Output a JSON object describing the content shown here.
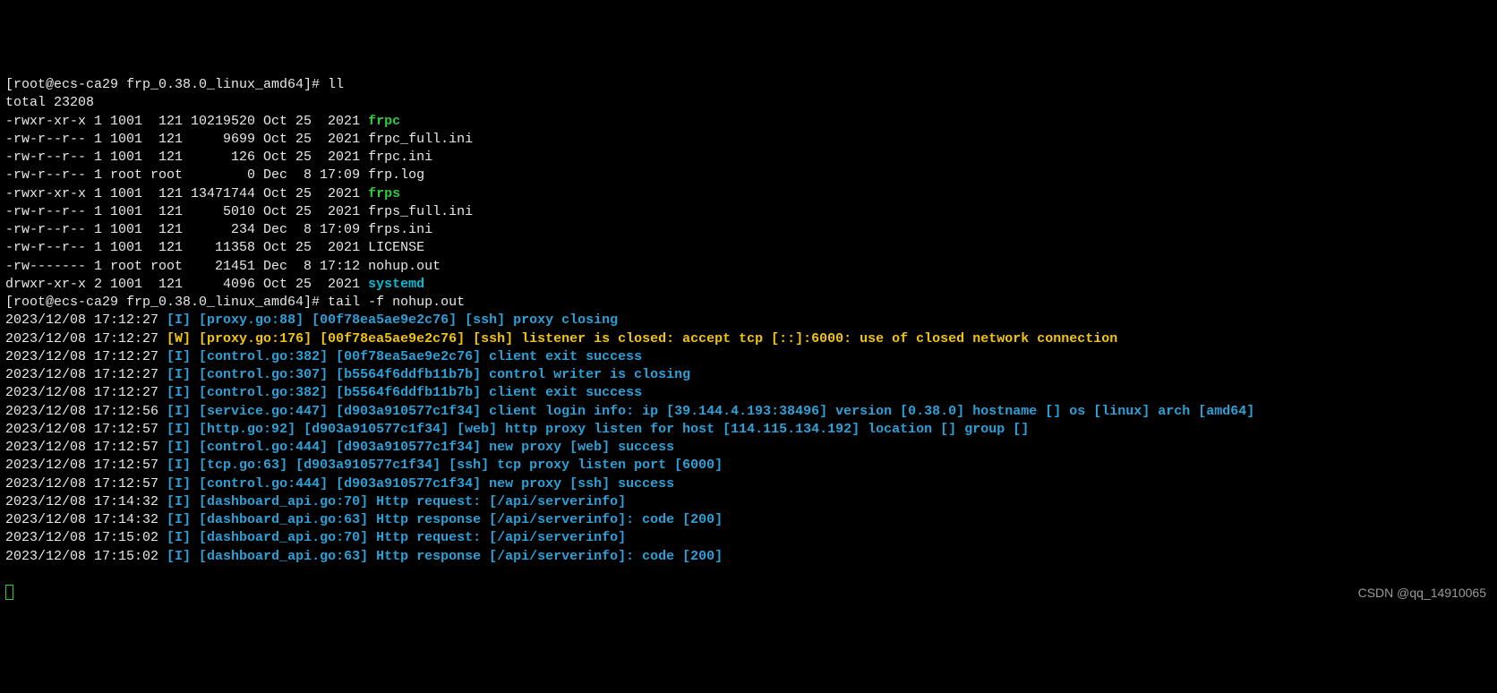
{
  "prompt1": "[root@ecs-ca29 frp_0.38.0_linux_amd64]# ll",
  "total": "total 23208",
  "ls": [
    {
      "perm": "-rwxr-xr-x 1 1001  121 10219520 Oct 25  2021 ",
      "name": "frpc",
      "cls": "green"
    },
    {
      "perm": "-rw-r--r-- 1 1001  121     9699 Oct 25  2021 ",
      "name": "frpc_full.ini",
      "cls": "white"
    },
    {
      "perm": "-rw-r--r-- 1 1001  121      126 Oct 25  2021 ",
      "name": "frpc.ini",
      "cls": "white"
    },
    {
      "perm": "-rw-r--r-- 1 root root        0 Dec  8 17:09 ",
      "name": "frp.log",
      "cls": "white"
    },
    {
      "perm": "-rwxr-xr-x 1 1001  121 13471744 Oct 25  2021 ",
      "name": "frps",
      "cls": "green"
    },
    {
      "perm": "-rw-r--r-- 1 1001  121     5010 Oct 25  2021 ",
      "name": "frps_full.ini",
      "cls": "white"
    },
    {
      "perm": "-rw-r--r-- 1 1001  121      234 Dec  8 17:09 ",
      "name": "frps.ini",
      "cls": "white"
    },
    {
      "perm": "-rw-r--r-- 1 1001  121    11358 Oct 25  2021 ",
      "name": "LICENSE",
      "cls": "white"
    },
    {
      "perm": "-rw------- 1 root root    21451 Dec  8 17:12 ",
      "name": "nohup.out",
      "cls": "white"
    },
    {
      "perm": "drwxr-xr-x 2 1001  121     4096 Oct 25  2021 ",
      "name": "systemd",
      "cls": "cyan"
    }
  ],
  "prompt2": "[root@ecs-ca29 frp_0.38.0_linux_amd64]# tail -f nohup.out",
  "log": [
    {
      "ts": "2023/12/08 17:12:27 ",
      "lvl": "[I]",
      "cls": "blue",
      "msg": " [proxy.go:88] [00f78ea5ae9e2c76] [ssh] proxy closing"
    },
    {
      "ts": "2023/12/08 17:12:27 ",
      "lvl": "[W]",
      "cls": "yellow",
      "msg": " [proxy.go:176] [00f78ea5ae9e2c76] [ssh] listener is closed: accept tcp [::]:6000: use of closed network connection"
    },
    {
      "ts": "2023/12/08 17:12:27 ",
      "lvl": "[I]",
      "cls": "blue",
      "msg": " [control.go:382] [00f78ea5ae9e2c76] client exit success"
    },
    {
      "ts": "2023/12/08 17:12:27 ",
      "lvl": "[I]",
      "cls": "blue",
      "msg": " [control.go:307] [b5564f6ddfb11b7b] control writer is closing"
    },
    {
      "ts": "2023/12/08 17:12:27 ",
      "lvl": "[I]",
      "cls": "blue",
      "msg": " [control.go:382] [b5564f6ddfb11b7b] client exit success"
    },
    {
      "ts": "2023/12/08 17:12:56 ",
      "lvl": "[I]",
      "cls": "blue",
      "msg": " [service.go:447] [d903a910577c1f34] client login info: ip [39.144.4.193:38496] version [0.38.0] hostname [] os [linux] arch [amd64]",
      "wrap": true
    },
    {
      "ts": "2023/12/08 17:12:57 ",
      "lvl": "[I]",
      "cls": "blue",
      "msg": " [http.go:92] [d903a910577c1f34] [web] http proxy listen for host [114.115.134.192] location [] group []"
    },
    {
      "ts": "2023/12/08 17:12:57 ",
      "lvl": "[I]",
      "cls": "blue",
      "msg": " [control.go:444] [d903a910577c1f34] new proxy [web] success"
    },
    {
      "ts": "2023/12/08 17:12:57 ",
      "lvl": "[I]",
      "cls": "blue",
      "msg": " [tcp.go:63] [d903a910577c1f34] [ssh] tcp proxy listen port [6000]"
    },
    {
      "ts": "2023/12/08 17:12:57 ",
      "lvl": "[I]",
      "cls": "blue",
      "msg": " [control.go:444] [d903a910577c1f34] new proxy [ssh] success"
    },
    {
      "ts": "2023/12/08 17:14:32 ",
      "lvl": "[I]",
      "cls": "blue",
      "msg": " [dashboard_api.go:70] Http request: [/api/serverinfo]"
    },
    {
      "ts": "2023/12/08 17:14:32 ",
      "lvl": "[I]",
      "cls": "blue",
      "msg": " [dashboard_api.go:63] Http response [/api/serverinfo]: code [200]"
    },
    {
      "ts": "2023/12/08 17:15:02 ",
      "lvl": "[I]",
      "cls": "blue",
      "msg": " [dashboard_api.go:70] Http request: [/api/serverinfo]"
    },
    {
      "ts": "2023/12/08 17:15:02 ",
      "lvl": "[I]",
      "cls": "blue",
      "msg": " [dashboard_api.go:63] Http response [/api/serverinfo]: code [200]"
    }
  ],
  "watermark": "CSDN @qq_14910065"
}
